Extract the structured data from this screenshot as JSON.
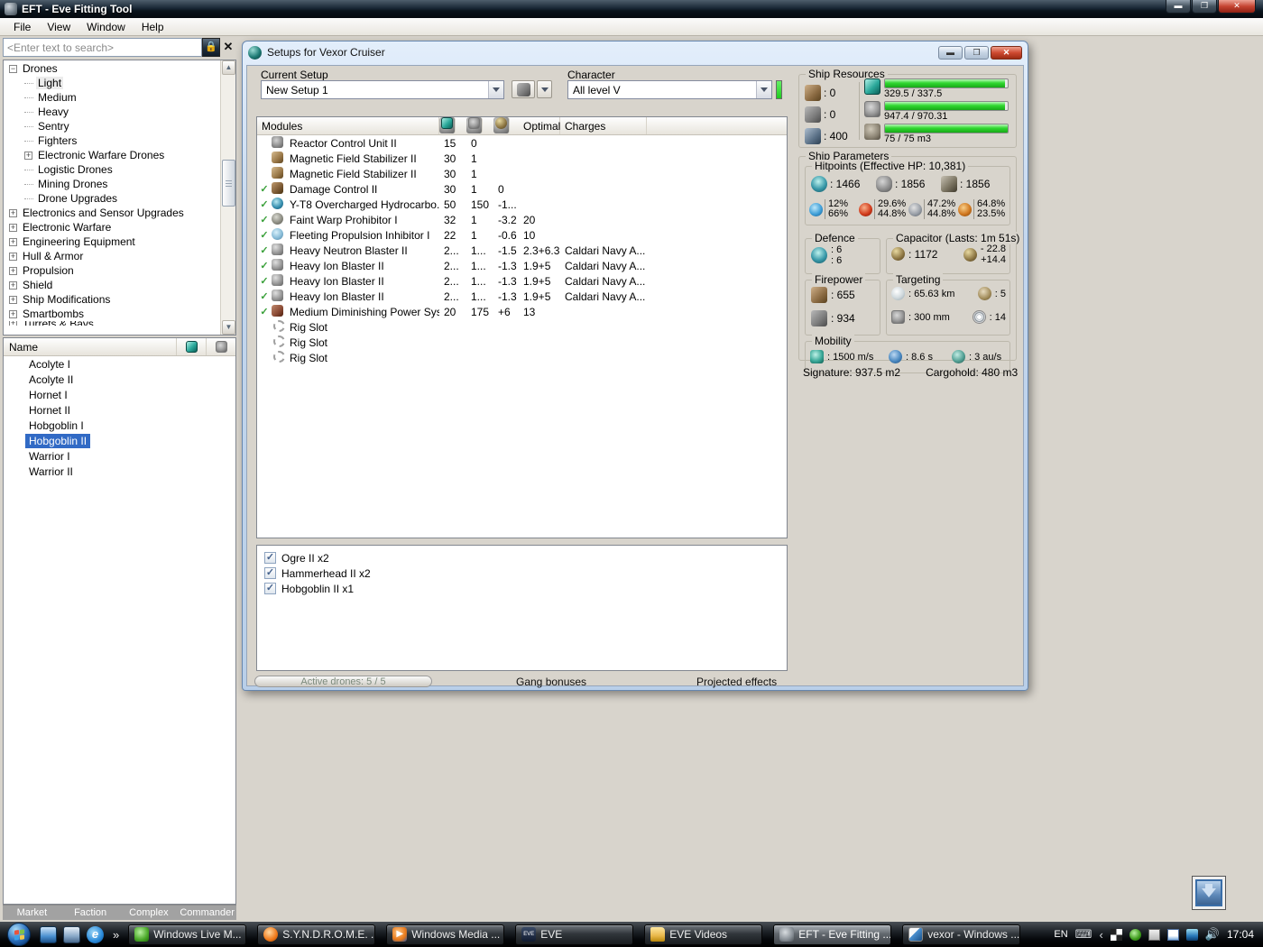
{
  "app": {
    "title": "EFT - Eve Fitting Tool",
    "menu": [
      "File",
      "View",
      "Window",
      "Help"
    ]
  },
  "sidebar": {
    "search_placeholder": "<Enter text to search>",
    "tree": [
      {
        "label": "Drones",
        "level": 0,
        "expander": "minus"
      },
      {
        "label": "Light",
        "level": 1,
        "expander": "none",
        "highlight": true
      },
      {
        "label": "Medium",
        "level": 1,
        "expander": "none"
      },
      {
        "label": "Heavy",
        "level": 1,
        "expander": "none"
      },
      {
        "label": "Sentry",
        "level": 1,
        "expander": "none"
      },
      {
        "label": "Fighters",
        "level": 1,
        "expander": "none"
      },
      {
        "label": "Electronic Warfare Drones",
        "level": 1,
        "expander": "plus"
      },
      {
        "label": "Logistic Drones",
        "level": 1,
        "expander": "none"
      },
      {
        "label": "Mining Drones",
        "level": 1,
        "expander": "none"
      },
      {
        "label": "Drone Upgrades",
        "level": 1,
        "expander": "none"
      },
      {
        "label": "Electronics and Sensor Upgrades",
        "level": 0,
        "expander": "plus"
      },
      {
        "label": "Electronic Warfare",
        "level": 0,
        "expander": "plus"
      },
      {
        "label": "Engineering Equipment",
        "level": 0,
        "expander": "plus"
      },
      {
        "label": "Hull & Armor",
        "level": 0,
        "expander": "plus"
      },
      {
        "label": "Propulsion",
        "level": 0,
        "expander": "plus"
      },
      {
        "label": "Shield",
        "level": 0,
        "expander": "plus"
      },
      {
        "label": "Ship Modifications",
        "level": 0,
        "expander": "plus"
      },
      {
        "label": "Smartbombs",
        "level": 0,
        "expander": "plus"
      },
      {
        "label": "Turrets & Bays",
        "level": 0,
        "expander": "plus",
        "clipped": true
      }
    ],
    "list": {
      "header": "Name",
      "items": [
        {
          "label": "Acolyte I"
        },
        {
          "label": "Acolyte II"
        },
        {
          "label": "Hornet I"
        },
        {
          "label": "Hornet II"
        },
        {
          "label": "Hobgoblin I"
        },
        {
          "label": "Hobgoblin II",
          "selected": true
        },
        {
          "label": "Warrior I"
        },
        {
          "label": "Warrior II"
        }
      ]
    },
    "tabs": [
      "Market",
      "Faction",
      "Complex",
      "Commander"
    ]
  },
  "setup_window": {
    "title": "Setups for Vexor Cruiser",
    "current_setup_label": "Current Setup",
    "current_setup_value": "New Setup 1",
    "character_label": "Character",
    "character_value": "All level V",
    "table": {
      "modules_header": "Modules",
      "optimal_header": "Optimal",
      "charges_header": "Charges",
      "rows": [
        {
          "check": false,
          "icon": "i-rcu",
          "name": "Reactor Control Unit II",
          "cpu": "15",
          "pg": "0",
          "cap": "",
          "optimal": "",
          "charges": ""
        },
        {
          "check": false,
          "icon": "i-magstab",
          "name": "Magnetic Field Stabilizer II",
          "cpu": "30",
          "pg": "1",
          "cap": "",
          "optimal": "",
          "charges": ""
        },
        {
          "check": false,
          "icon": "i-magstab",
          "name": "Magnetic Field Stabilizer II",
          "cpu": "30",
          "pg": "1",
          "cap": "",
          "optimal": "",
          "charges": ""
        },
        {
          "check": true,
          "icon": "i-dc",
          "name": "Damage Control II",
          "cpu": "30",
          "pg": "1",
          "cap": "0",
          "optimal": "",
          "charges": ""
        },
        {
          "check": true,
          "icon": "i-ab",
          "name": "Y-T8 Overcharged Hydrocarbo...",
          "cpu": "50",
          "pg": "150",
          "cap": "-1...",
          "optimal": "",
          "charges": ""
        },
        {
          "check": true,
          "icon": "i-disr",
          "name": "Faint Warp Prohibitor I",
          "cpu": "32",
          "pg": "1",
          "cap": "-3.2",
          "optimal": "20",
          "charges": ""
        },
        {
          "check": true,
          "icon": "i-web",
          "name": "Fleeting Propulsion Inhibitor I",
          "cpu": "22",
          "pg": "1",
          "cap": "-0.6",
          "optimal": "10",
          "charges": ""
        },
        {
          "check": true,
          "icon": "i-blaster",
          "name": "Heavy Neutron Blaster II",
          "cpu": "2...",
          "pg": "1...",
          "cap": "-1.5",
          "optimal": "2.3+6.3",
          "charges": "Caldari Navy A..."
        },
        {
          "check": true,
          "icon": "i-blaster",
          "name": "Heavy Ion Blaster II",
          "cpu": "2...",
          "pg": "1...",
          "cap": "-1.3",
          "optimal": "1.9+5",
          "charges": "Caldari Navy A..."
        },
        {
          "check": true,
          "icon": "i-blaster",
          "name": "Heavy Ion Blaster II",
          "cpu": "2...",
          "pg": "1...",
          "cap": "-1.3",
          "optimal": "1.9+5",
          "charges": "Caldari Navy A..."
        },
        {
          "check": true,
          "icon": "i-blaster",
          "name": "Heavy Ion Blaster II",
          "cpu": "2...",
          "pg": "1...",
          "cap": "-1.3",
          "optimal": "1.9+5",
          "charges": "Caldari Navy A..."
        },
        {
          "check": true,
          "icon": "i-pds",
          "name": "Medium Diminishing Power Sys...",
          "cpu": "20",
          "pg": "175",
          "cap": "+6",
          "optimal": "13",
          "charges": ""
        },
        {
          "check": false,
          "icon": "i-rig",
          "name": "Rig Slot",
          "rig": true
        },
        {
          "check": false,
          "icon": "i-rig",
          "name": "Rig Slot",
          "rig": true
        },
        {
          "check": false,
          "icon": "i-rig",
          "name": "Rig Slot",
          "rig": true
        }
      ]
    },
    "drones": [
      {
        "label": "Ogre II x2",
        "checked": true
      },
      {
        "label": "Hammerhead II x2",
        "checked": true
      },
      {
        "label": "Hobgoblin II x1",
        "checked": true
      }
    ],
    "footer": {
      "active_drones": "Active drones: 5 / 5",
      "gang_bonuses": "Gang bonuses",
      "projected_effects": "Projected effects"
    }
  },
  "stats": {
    "resources": {
      "title": "Ship Resources",
      "turrets": ": 0",
      "launchers": ": 0",
      "calibration": ": 400",
      "bars": [
        {
          "icon": "i-cpu",
          "text": "329.5 / 337.5",
          "pct": 97.6
        },
        {
          "icon": "i-pg",
          "text": "947.4 / 970.31",
          "pct": 97.6
        },
        {
          "icon": "i-drone",
          "text": "75 / 75 m3",
          "pct": 100
        }
      ]
    },
    "parameters_title": "Ship Parameters",
    "hitpoints": {
      "title": "Hitpoints (Effective HP: 10,381)",
      "shield": ": 1466",
      "armor": ": 1856",
      "hull": ": 1856",
      "resists": [
        {
          "kind": "em",
          "top": "12%",
          "bottom": "66%"
        },
        {
          "kind": "thermal",
          "top": "29.6%",
          "bottom": "44.8%"
        },
        {
          "kind": "kinetic",
          "top": "47.2%",
          "bottom": "44.8%"
        },
        {
          "kind": "explosive",
          "top": "64.8%",
          "bottom": "23.5%"
        }
      ]
    },
    "defence": {
      "title": "Defence",
      "v1": ": 6",
      "v2": ": 6"
    },
    "capacitor": {
      "title": "Capacitor (Lasts: 1m 51s)",
      "amount": ": 1172",
      "neg": "- 22.8",
      "pos": "+14.4"
    },
    "firepower": {
      "title": "Firepower",
      "dps": ": 655",
      "volley": ": 934"
    },
    "targeting": {
      "title": "Targeting",
      "range": ": 65.63 km",
      "sensor": ": 5",
      "scanres": ": 300 mm",
      "maxtargets": ": 14"
    },
    "mobility": {
      "title": "Mobility",
      "speed": ": 1500 m/s",
      "align": ": 8.6 s",
      "warp": ": 3 au/s"
    },
    "signature": "Signature: 937.5 m2",
    "cargohold": "Cargohold: 480 m3"
  },
  "taskbar": {
    "buttons": [
      {
        "label": "Windows Live M...",
        "icon": "t-msn",
        "glyph": ""
      },
      {
        "label": "S.Y.N.D.R.O.M.E. ...",
        "icon": "t-ff",
        "glyph": ""
      },
      {
        "label": "Windows Media ...",
        "icon": "t-wmp",
        "glyph": "▶"
      },
      {
        "label": "EVE",
        "icon": "t-eve",
        "glyph": "EVE"
      },
      {
        "label": "EVE Videos",
        "icon": "t-folder",
        "glyph": ""
      },
      {
        "label": "EFT - Eve Fitting ...",
        "icon": "t-eft",
        "glyph": "",
        "active": true
      },
      {
        "label": "vexor - Windows ...",
        "icon": "t-photo",
        "glyph": ""
      }
    ],
    "tray": {
      "lang": "EN",
      "clock": "17:04"
    }
  }
}
